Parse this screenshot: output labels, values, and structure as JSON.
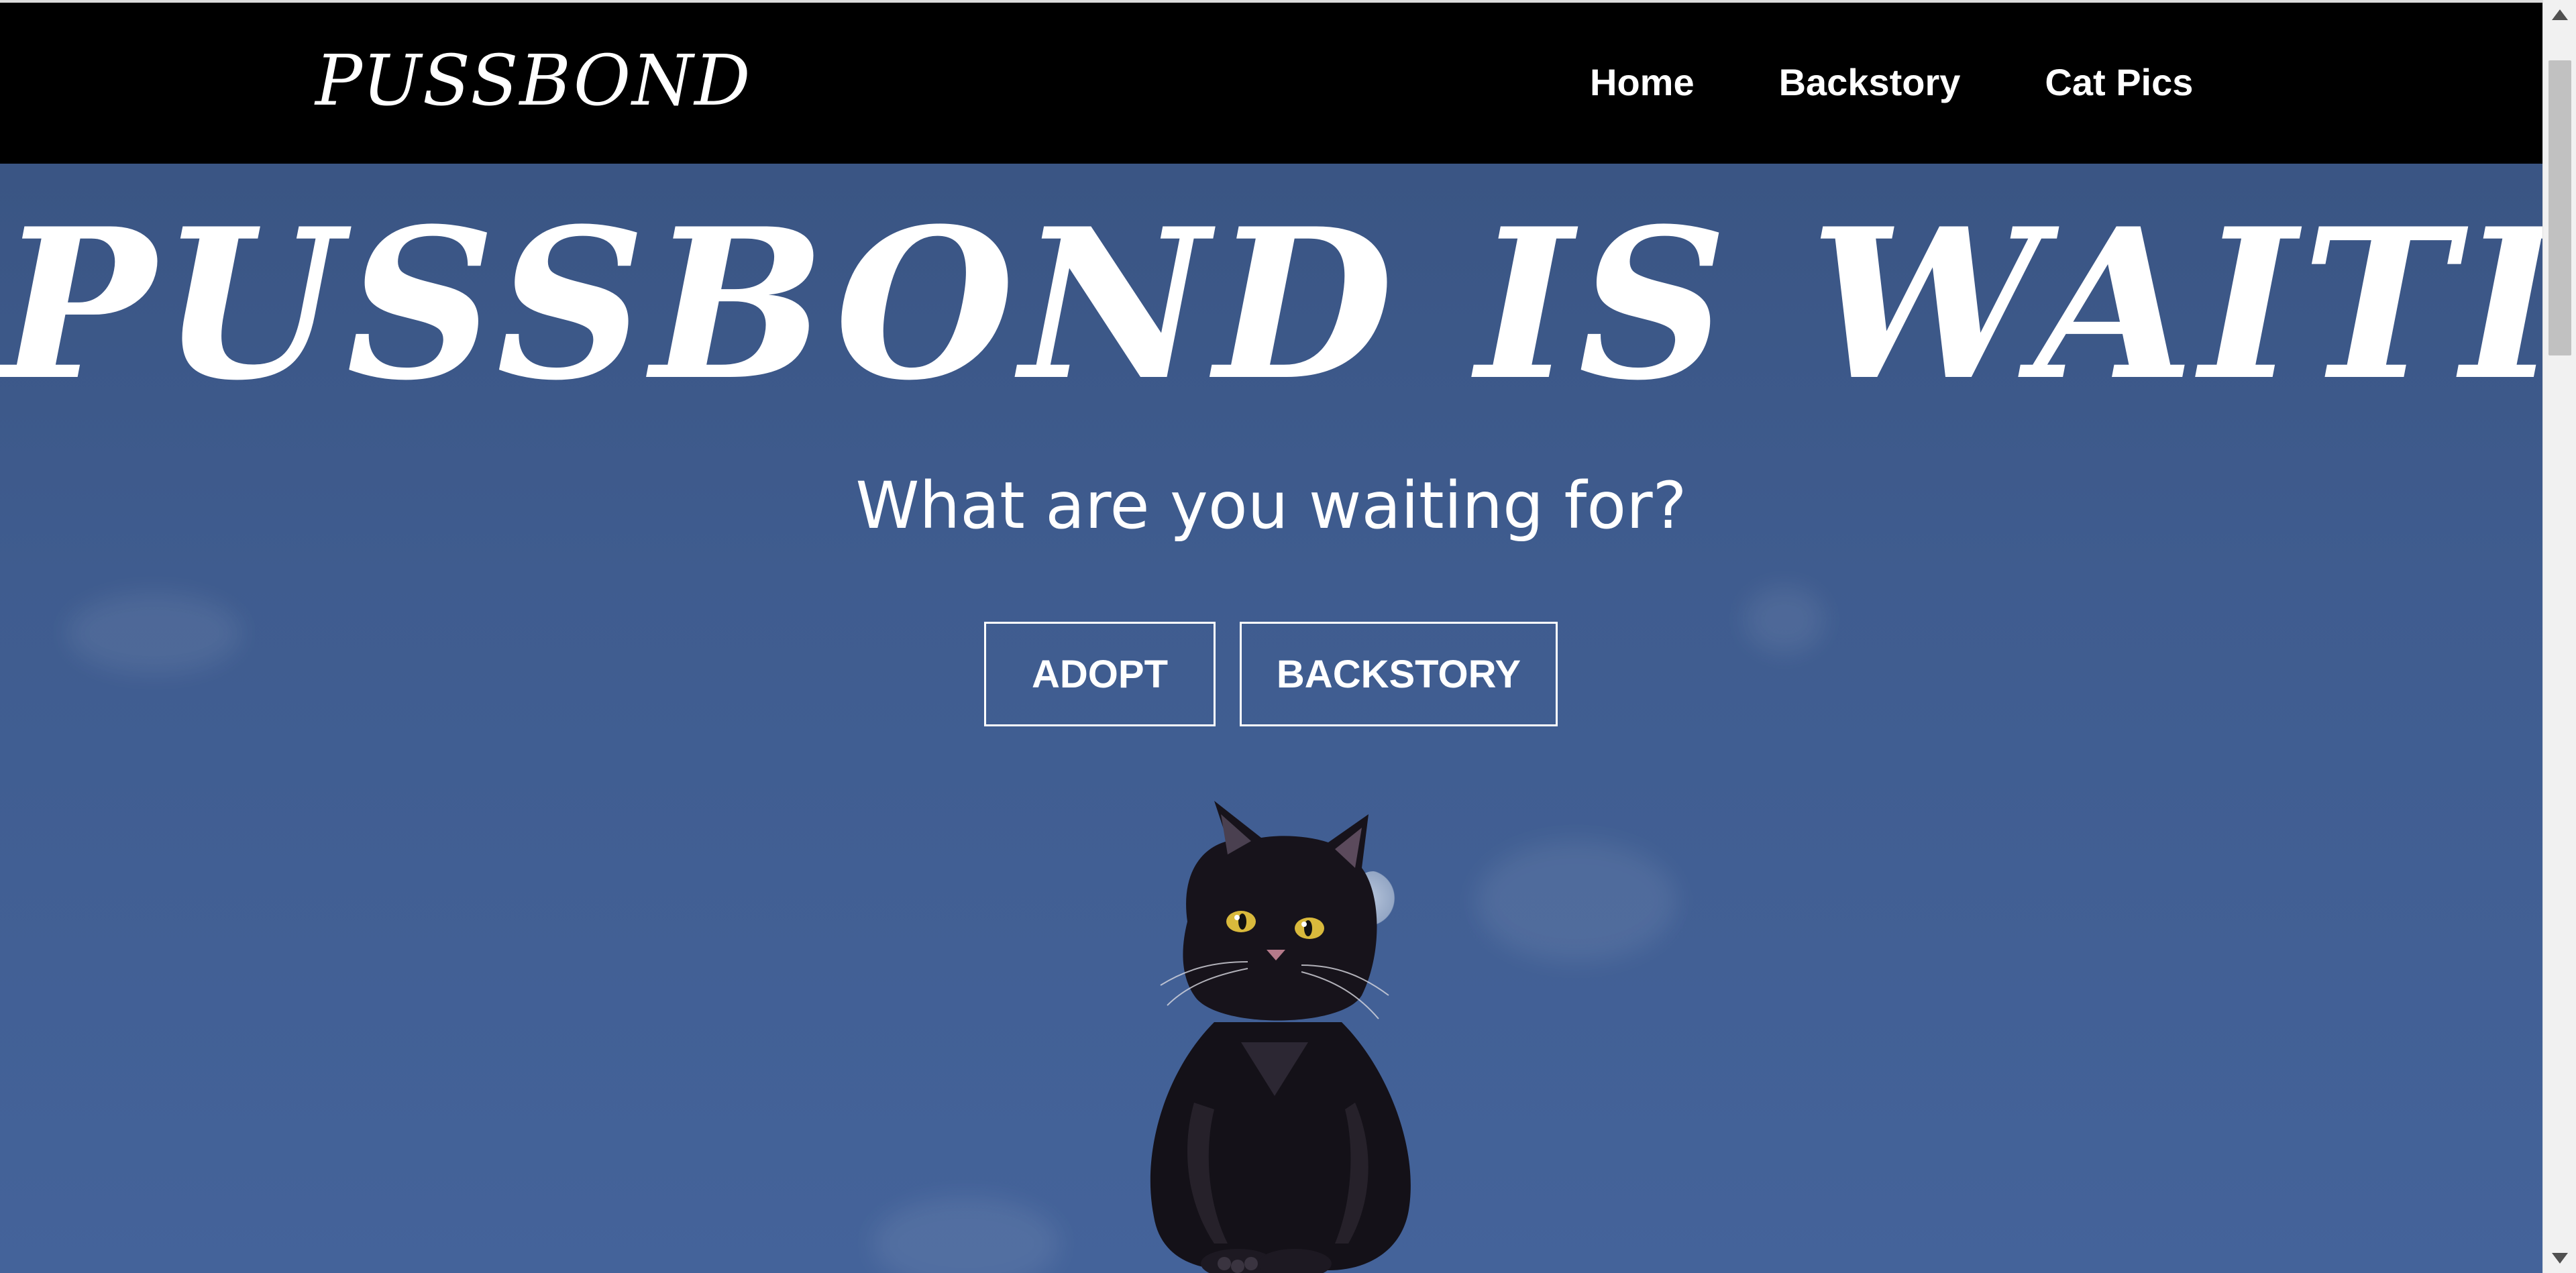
{
  "navbar": {
    "brand": "PUSSBOND",
    "links": [
      {
        "label": "Home"
      },
      {
        "label": "Backstory"
      },
      {
        "label": "Cat Pics"
      }
    ]
  },
  "hero": {
    "title": "PUSSBOND IS WAITING",
    "subtitle": "What are you waiting for?",
    "buttons": {
      "adopt": "ADOPT",
      "backstory": "BACKSTORY"
    }
  },
  "colors": {
    "navbar_bg": "#000000",
    "hero_bg": "#3f5c8f",
    "text": "#ffffff"
  },
  "icons": {
    "hero_image": "black-cat-illustration"
  }
}
